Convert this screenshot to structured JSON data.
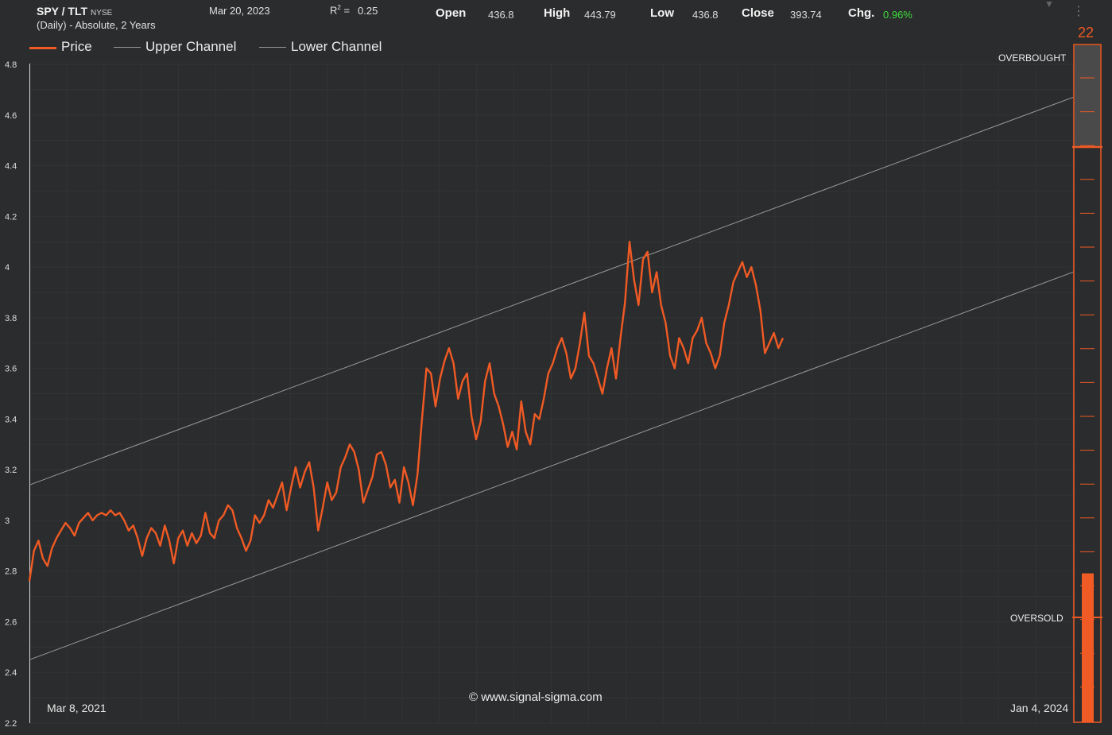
{
  "header": {
    "symbol": "SPY / TLT",
    "exchange": "NYSE",
    "subtitle": "(Daily) - Absolute, 2 Years",
    "date": "Mar 20, 2023",
    "r2_label": "R",
    "r2_sup": "2",
    "r2_eq": " =",
    "r2_value": "0.25",
    "open_label": "Open",
    "open_value": "436.8",
    "high_label": "High",
    "high_value": "443.79",
    "low_label": "Low",
    "low_value": "436.8",
    "close_label": "Close",
    "close_value": "393.74",
    "chg_label": "Chg.",
    "chg_value": "0.96%"
  },
  "legend": {
    "price": "Price",
    "upper": "Upper Channel",
    "lower": "Lower Channel"
  },
  "footer": {
    "copyright": "© www.signal-sigma.com",
    "start_date": "Mar 8, 2021",
    "end_date": "Jan 4, 2024"
  },
  "gauge": {
    "value": "22",
    "overbought": "OVERBOUGHT",
    "oversold": "OVERSOLD",
    "fill_fraction": 0.22
  },
  "colors": {
    "price": "#f05a24",
    "channel": "#9a9a9a",
    "background": "#2b2c2d",
    "positive": "#3ddc3d"
  },
  "chart_data": {
    "type": "line",
    "ylim": [
      2.2,
      4.8
    ],
    "yticks": [
      "4.8",
      "4.6",
      "4.4",
      "4.2",
      "4",
      "3.8",
      "3.6",
      "3.4",
      "3.2",
      "3",
      "2.8",
      "2.6",
      "2.4",
      "2.2"
    ],
    "ytick_values": [
      4.8,
      4.6,
      4.4,
      4.2,
      4.0,
      3.8,
      3.6,
      3.4,
      3.2,
      3.0,
      2.8,
      2.6,
      2.4,
      2.2
    ],
    "x_start": "Mar 8, 2021",
    "x_end": "Jan 4, 2024",
    "grid": true,
    "series": [
      {
        "name": "Price",
        "values": [
          2.76,
          2.88,
          2.92,
          2.85,
          2.82,
          2.89,
          2.93,
          2.96,
          2.99,
          2.97,
          2.94,
          2.99,
          3.01,
          3.03,
          3.0,
          3.02,
          3.03,
          3.02,
          3.04,
          3.02,
          3.03,
          3.0,
          2.96,
          2.98,
          2.93,
          2.86,
          2.93,
          2.97,
          2.95,
          2.9,
          2.98,
          2.92,
          2.83,
          2.93,
          2.96,
          2.9,
          2.95,
          2.91,
          2.94,
          3.03,
          2.95,
          2.93,
          3.0,
          3.02,
          3.06,
          3.04,
          2.97,
          2.93,
          2.88,
          2.92,
          3.02,
          2.99,
          3.02,
          3.08,
          3.05,
          3.1,
          3.15,
          3.04,
          3.13,
          3.21,
          3.13,
          3.19,
          3.23,
          3.13,
          2.96,
          3.05,
          3.15,
          3.08,
          3.11,
          3.21,
          3.25,
          3.3,
          3.27,
          3.2,
          3.07,
          3.12,
          3.17,
          3.26,
          3.27,
          3.22,
          3.13,
          3.16,
          3.07,
          3.21,
          3.15,
          3.06,
          3.18,
          3.4,
          3.6,
          3.58,
          3.45,
          3.56,
          3.63,
          3.68,
          3.62,
          3.48,
          3.55,
          3.58,
          3.41,
          3.32,
          3.39,
          3.55,
          3.62,
          3.5,
          3.45,
          3.38,
          3.29,
          3.35,
          3.28,
          3.47,
          3.35,
          3.3,
          3.42,
          3.4,
          3.48,
          3.58,
          3.62,
          3.68,
          3.72,
          3.66,
          3.56,
          3.6,
          3.7,
          3.82,
          3.65,
          3.62,
          3.56,
          3.5,
          3.6,
          3.68,
          3.56,
          3.72,
          3.86,
          4.1,
          3.95,
          3.85,
          4.03,
          4.06,
          3.9,
          3.98,
          3.85,
          3.78,
          3.65,
          3.6,
          3.72,
          3.68,
          3.62,
          3.72,
          3.75,
          3.8,
          3.7,
          3.66,
          3.6,
          3.65,
          3.78,
          3.85,
          3.94,
          3.98,
          4.02,
          3.96,
          4.0,
          3.93,
          3.83,
          3.66,
          3.7,
          3.74,
          3.68,
          3.72
        ]
      }
    ],
    "upper_channel": {
      "start": 3.14,
      "end": 4.67
    },
    "lower_channel": {
      "start": 2.45,
      "end": 3.98
    }
  }
}
